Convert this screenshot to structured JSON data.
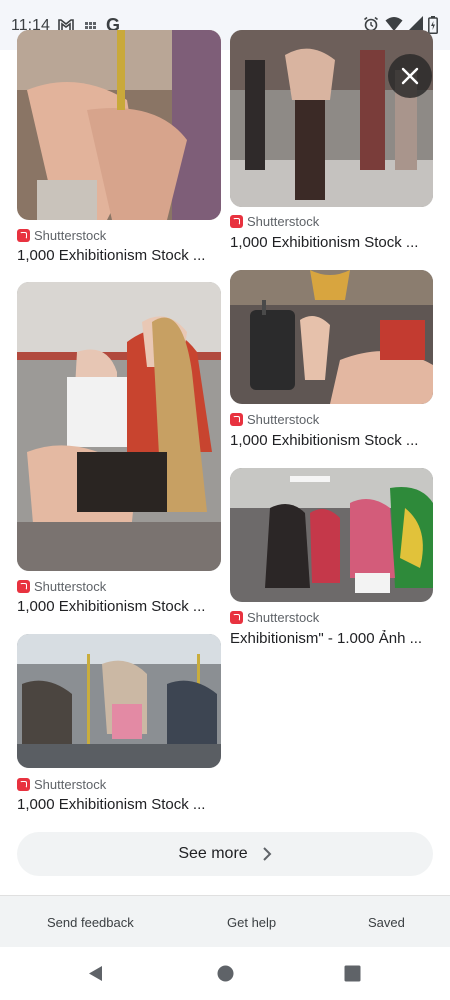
{
  "status_bar": {
    "time": "11:14",
    "google_letter": "G",
    "icons": [
      "gmail-icon",
      "grid-icon",
      "google-icon",
      "alarm-icon",
      "wifi-icon",
      "signal-icon",
      "battery-icon"
    ]
  },
  "results": [
    {
      "source": "Shutterstock",
      "caption": "1,000 Exhibitionism Stock ..."
    },
    {
      "source": "Shutterstock",
      "caption": "1,000 Exhibitionism Stock ..."
    },
    {
      "source": "Shutterstock",
      "caption": "1,000 Exhibitionism Stock ..."
    },
    {
      "source": "Shutterstock",
      "caption": "1,000 Exhibitionism Stock ..."
    },
    {
      "source": "Shutterstock",
      "caption": "Exhibitionism\" - 1.000 Ảnh ..."
    },
    {
      "source": "Shutterstock",
      "caption": "1,000 Exhibitionism Stock ..."
    }
  ],
  "see_more": {
    "label": "See more"
  },
  "footer": {
    "send_feedback": "Send feedback",
    "get_help": "Get help",
    "saved": "Saved"
  },
  "colors": {
    "source_brand": "#e8323f",
    "status_bar_bg": "#f4f6fa",
    "button_bg": "#f1f3f4"
  }
}
